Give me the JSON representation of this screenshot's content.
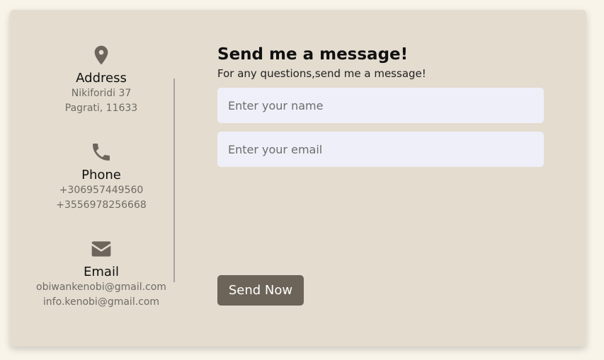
{
  "contact": {
    "address": {
      "icon": "map-pin-icon",
      "title": "Address",
      "lines": [
        "Nikiforidi 37",
        "Pagrati, 11633"
      ]
    },
    "phone": {
      "icon": "phone-icon",
      "title": "Phone",
      "lines": [
        "+306957449560",
        "+3556978256668"
      ]
    },
    "email": {
      "icon": "envelope-icon",
      "title": "Email",
      "lines": [
        "obiwankenobi@gmail.com",
        "info.kenobi@gmail.com"
      ]
    }
  },
  "form": {
    "title": "Send me a message!",
    "subtitle": "For any questions,send me a message!",
    "name_placeholder": "Enter your name",
    "name_value": "",
    "email_placeholder": "Enter your email",
    "email_value": "",
    "submit_label": "Send Now"
  },
  "colors": {
    "page_background": "#f8f4ea",
    "card_background": "#e3dccf",
    "icon": "#6b655c",
    "input_background": "#eeeff8",
    "button": "#6c6458",
    "button_text": "#ffffff"
  }
}
